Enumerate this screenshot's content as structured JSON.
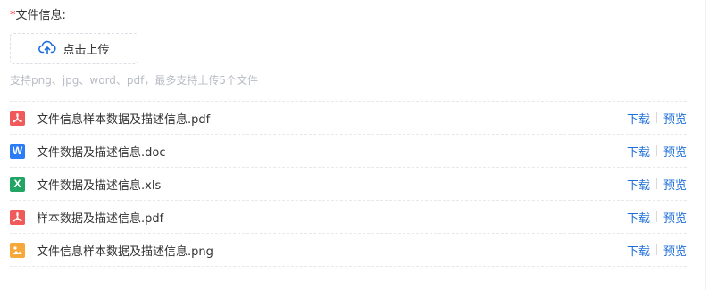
{
  "form": {
    "required_mark": "*",
    "label": "文件信息:"
  },
  "upload": {
    "icon": "cloud-upload-icon",
    "button_label": "点击上传",
    "hint": "支持png、jpg、word、pdf，最多支持上传5个文件"
  },
  "colors": {
    "link": "#1e6fd9",
    "pdf": "#f05a5a",
    "word": "#2b7cf6",
    "excel": "#21a464",
    "image": "#f7a83a"
  },
  "files": [
    {
      "name": "文件信息样本数据及描述信息.pdf",
      "type": "pdf",
      "icon": "pdf-file-icon",
      "download": "下载",
      "preview": "预览"
    },
    {
      "name": "文件数据及描述信息.doc",
      "type": "word",
      "icon": "word-file-icon",
      "download": "下载",
      "preview": "预览"
    },
    {
      "name": "文件数据及描述信息.xls",
      "type": "excel",
      "icon": "excel-file-icon",
      "download": "下载",
      "preview": "预览"
    },
    {
      "name": "样本数据及描述信息.pdf",
      "type": "pdf",
      "icon": "pdf-file-icon",
      "download": "下载",
      "preview": "预览"
    },
    {
      "name": "文件信息样本数据及描述信息.png",
      "type": "image",
      "icon": "image-file-icon",
      "download": "下载",
      "preview": "预览"
    }
  ]
}
